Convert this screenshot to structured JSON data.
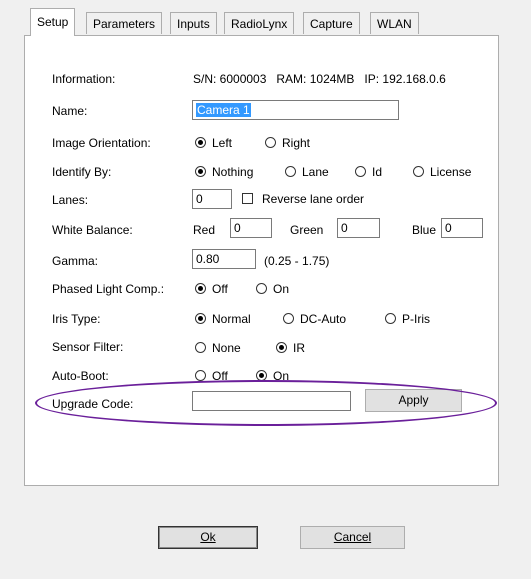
{
  "tabs": [
    "Setup",
    "Parameters",
    "Inputs",
    "RadioLynx",
    "Capture",
    "WLAN"
  ],
  "info": {
    "label": "Information:",
    "value": "S/N: 6000003   RAM: 1024MB   IP: 192.168.0.6"
  },
  "name": {
    "label": "Name:",
    "value": "Camera 1"
  },
  "orientation": {
    "label": "Image Orientation:",
    "options": [
      "Left",
      "Right"
    ],
    "selected": "Left"
  },
  "identify": {
    "label": "Identify By:",
    "options": [
      "Nothing",
      "Lane",
      "Id",
      "License"
    ],
    "selected": "Nothing"
  },
  "lanes": {
    "label": "Lanes:",
    "value": "0",
    "reverse_label": "Reverse lane order",
    "reverse_checked": false
  },
  "white_balance": {
    "label": "White Balance:",
    "red_label": "Red",
    "red": "0",
    "green_label": "Green",
    "green": "0",
    "blue_label": "Blue",
    "blue": "0"
  },
  "gamma": {
    "label": "Gamma:",
    "value": "0.80",
    "range": "(0.25 - 1.75)"
  },
  "phased": {
    "label": "Phased Light Comp.:",
    "options": [
      "Off",
      "On"
    ],
    "selected": "Off"
  },
  "iris": {
    "label": "Iris Type:",
    "options": [
      "Normal",
      "DC-Auto",
      "P-Iris"
    ],
    "selected": "Normal"
  },
  "sensor": {
    "label": "Sensor Filter:",
    "options": [
      "None",
      "IR"
    ],
    "selected": "IR"
  },
  "autoboot": {
    "label": "Auto-Boot:",
    "options": [
      "Off",
      "On"
    ],
    "selected": "On"
  },
  "upgrade": {
    "label": "Upgrade Code:",
    "value": "",
    "apply": "Apply"
  },
  "buttons": {
    "ok": "Ok",
    "cancel": "Cancel"
  },
  "colors": {
    "highlight_oval": "#6a1f9a",
    "selection": "#3399ff"
  }
}
